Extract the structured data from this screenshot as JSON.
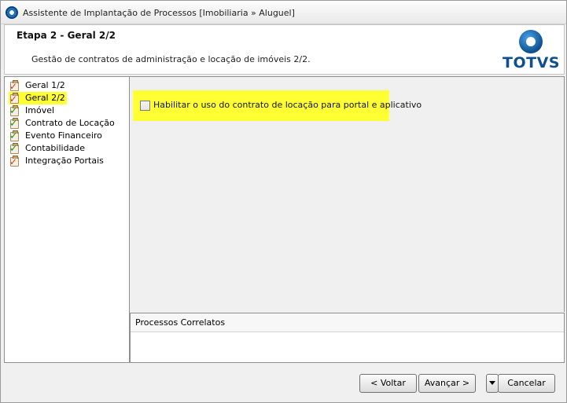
{
  "window": {
    "title": "Assistente de Implantação de Processos [Imobiliaria » Aluguel]"
  },
  "header": {
    "step_title": "Etapa 2 - Geral 2/2",
    "step_description": "Gestão de contratos de administração e locação de imóveis 2/2.",
    "logo_text": "TOTVS"
  },
  "tree": {
    "items": [
      {
        "label": "Geral 1/2",
        "icon": "clipboard-icon",
        "status": "pending"
      },
      {
        "label": "Geral 2/2",
        "icon": "clipboard-icon",
        "status": "current",
        "selected": true
      },
      {
        "label": "Imóvel",
        "icon": "green-check-icon",
        "status": "done"
      },
      {
        "label": "Contrato de Locação",
        "icon": "green-check-icon",
        "status": "done"
      },
      {
        "label": "Evento Financeiro",
        "icon": "green-check-icon",
        "status": "done"
      },
      {
        "label": "Contabilidade",
        "icon": "green-check-icon",
        "status": "done"
      },
      {
        "label": "Integração Portais",
        "icon": "clipboard-icon",
        "status": "pending"
      }
    ]
  },
  "main": {
    "option_label": "Habilitar o uso do contrato de locação para portal e aplicativo",
    "option_checked": false
  },
  "related": {
    "header": "Processos Correlatos"
  },
  "buttons": {
    "back": "< Voltar",
    "next": "Avançar >",
    "cancel": "Cancelar"
  },
  "colors": {
    "highlight": "#ffff33",
    "brand": "#0d4f8f"
  }
}
